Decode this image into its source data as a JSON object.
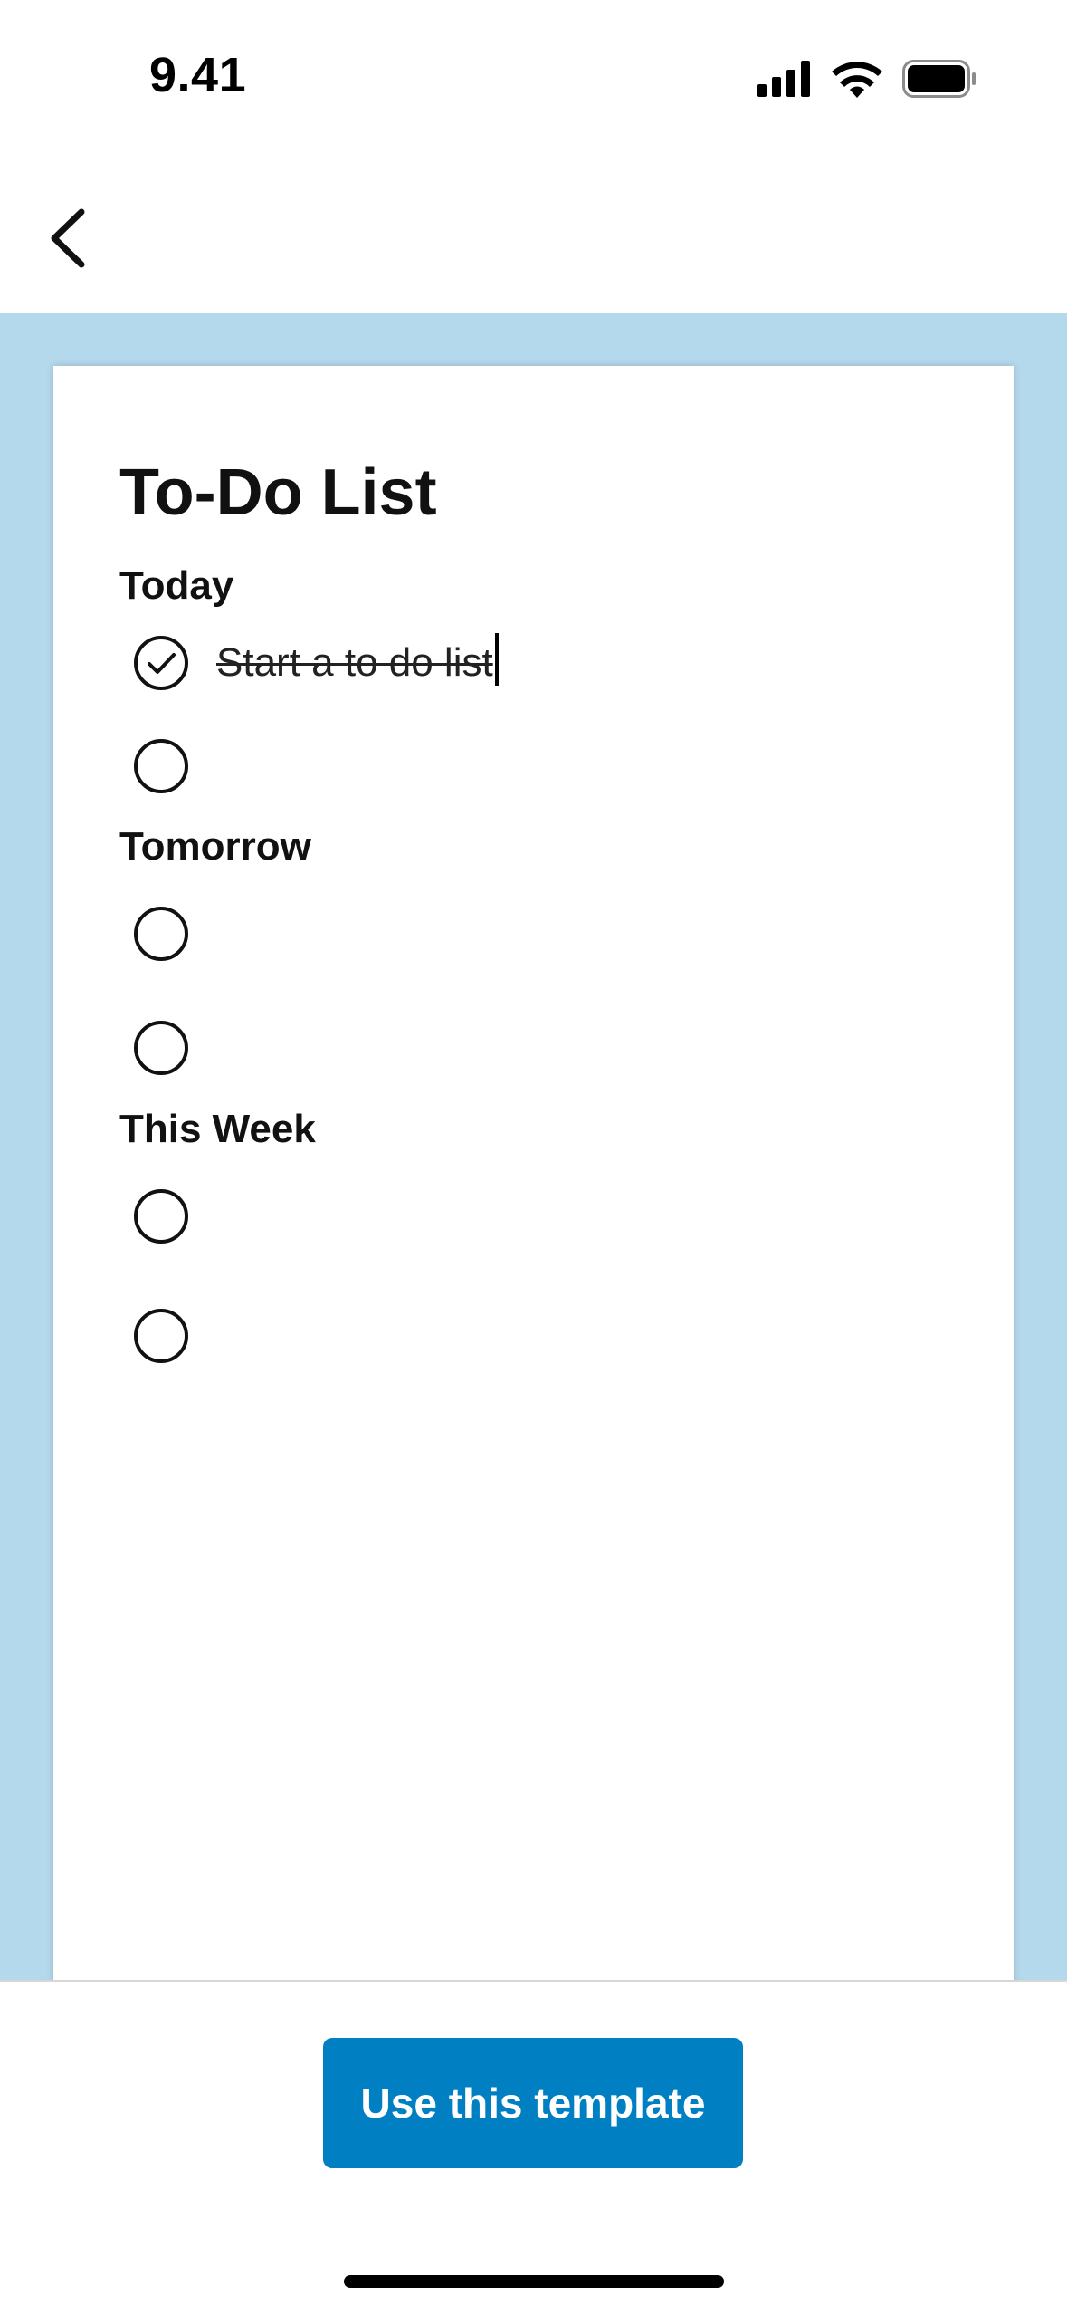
{
  "status_bar": {
    "time": "9.41",
    "icons": [
      "cellular-signal-icon",
      "wifi-icon",
      "battery-icon"
    ]
  },
  "nav": {
    "back_icon": "chevron-left-icon"
  },
  "document": {
    "title": "To-Do List",
    "sections": [
      {
        "heading": "Today",
        "tasks": [
          {
            "text": "Start a to do list",
            "checked": true
          },
          {
            "text": "",
            "checked": false
          }
        ]
      },
      {
        "heading": "Tomorrow",
        "tasks": [
          {
            "text": "",
            "checked": false
          },
          {
            "text": "",
            "checked": false
          }
        ]
      },
      {
        "heading": "This Week",
        "tasks": [
          {
            "text": "",
            "checked": false
          },
          {
            "text": "",
            "checked": false
          }
        ]
      }
    ]
  },
  "actions": {
    "use_template_label": "Use this template"
  },
  "colors": {
    "preview_background": "#b5d9ec",
    "primary_button": "#0080c2"
  }
}
